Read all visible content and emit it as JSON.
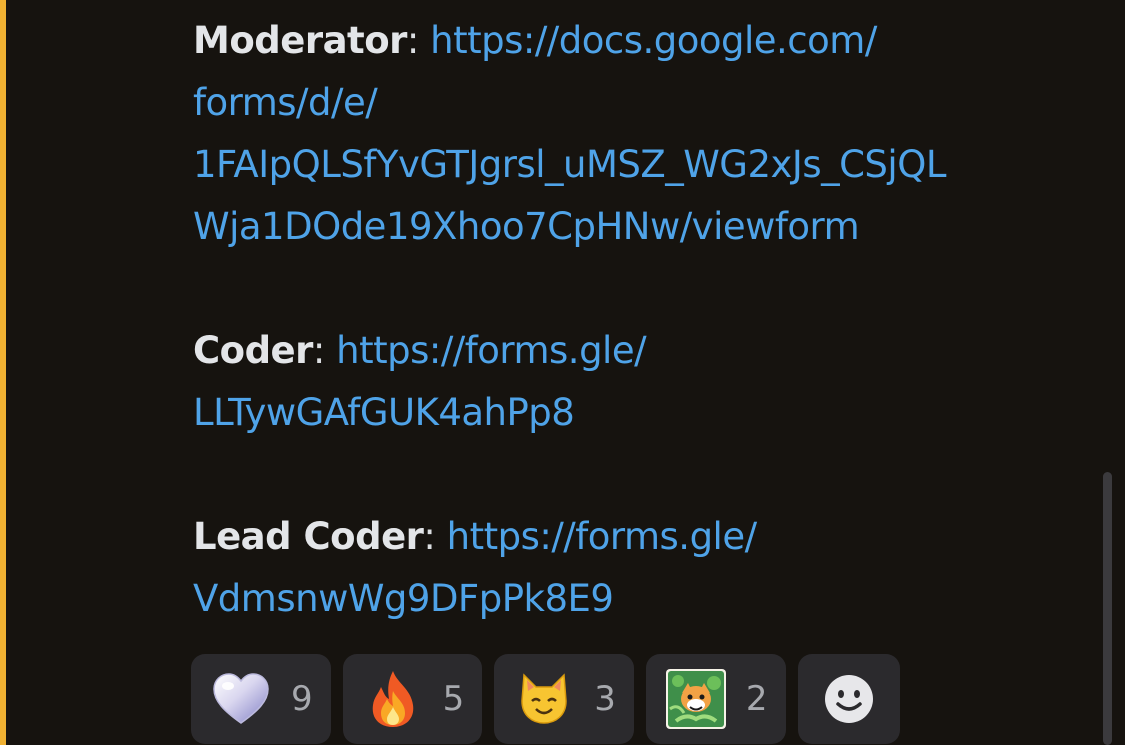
{
  "message": {
    "entries": [
      {
        "label": "Moderator",
        "separator": ": ",
        "url_lines": [
          "https://docs.google.com/",
          "forms/d/e/",
          "1FAIpQLSfYvGTJgrsl_uMSZ_WG2xJs_CSjQL",
          "Wja1DOde19Xhoo7CpHNw/viewform"
        ]
      },
      {
        "label": "Coder",
        "separator": ": ",
        "url_lines": [
          "https://forms.gle/",
          "LLTywGAfGUK4ahPp8"
        ]
      },
      {
        "label": "Lead Coder",
        "separator": ": ",
        "url_lines": [
          "https://forms.gle/",
          "VdmsnwWg9DFpPk8E9"
        ]
      }
    ]
  },
  "reactions": [
    {
      "icon": "heart-icon",
      "count": "9"
    },
    {
      "icon": "fire-icon",
      "count": "5"
    },
    {
      "icon": "cat-face-icon",
      "count": "3"
    },
    {
      "icon": "custom-emoji-icon",
      "count": "2"
    }
  ],
  "add_reaction": {
    "icon": "smiley-add-reaction-icon"
  },
  "colors": {
    "background": "#16130f",
    "link": "#4fa3e8",
    "accent": "#f0b132",
    "reaction_bg": "#2b2a2d"
  }
}
